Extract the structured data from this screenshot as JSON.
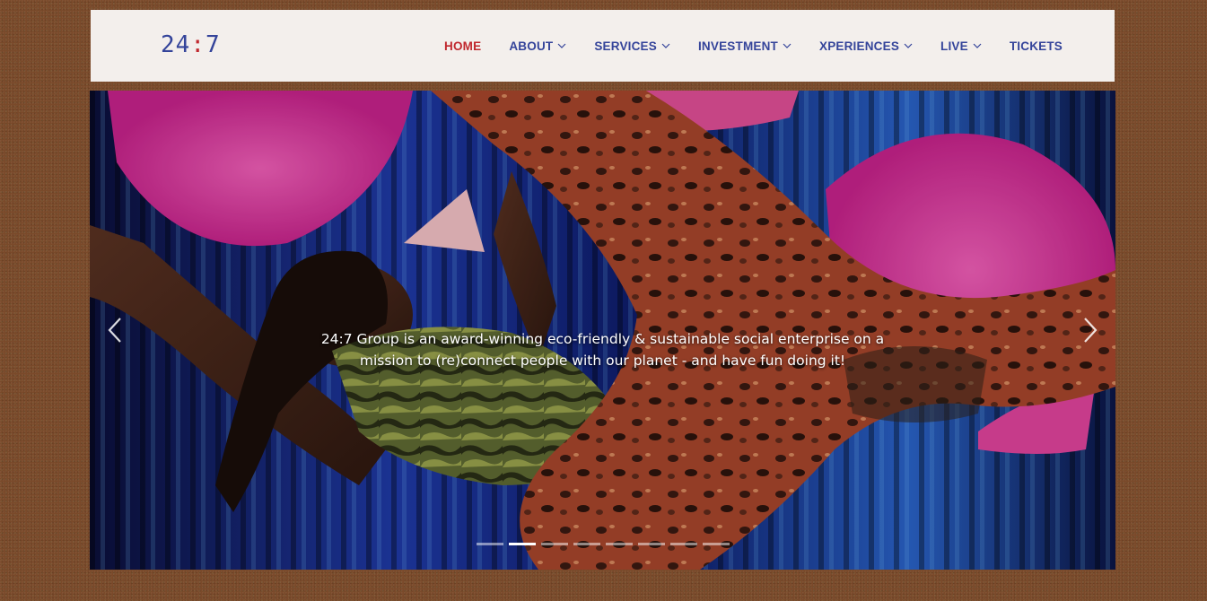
{
  "header": {
    "logo": {
      "left": "24",
      "colon": ":",
      "right": "7"
    },
    "nav": [
      {
        "label": "HOME",
        "dropdown": false,
        "active": true
      },
      {
        "label": "ABOUT",
        "dropdown": true,
        "active": false
      },
      {
        "label": "SERVICES",
        "dropdown": true,
        "active": false
      },
      {
        "label": "INVESTMENT",
        "dropdown": true,
        "active": false
      },
      {
        "label": "XPERIENCES",
        "dropdown": true,
        "active": false
      },
      {
        "label": "LIVE",
        "dropdown": true,
        "active": false
      },
      {
        "label": "TICKETS",
        "dropdown": false,
        "active": false
      }
    ]
  },
  "hero": {
    "caption_line1": "24:7 Group is an award-winning eco-friendly & sustainable social enterprise on a",
    "caption_line2": "mission to (re)connect people with our planet - and have fun doing it!",
    "prev_icon": "chevron-left-icon",
    "next_icon": "chevron-right-icon",
    "slide_count": 8,
    "active_slide": 2
  },
  "colors": {
    "nav_text": "#34449a",
    "nav_active": "#c0282e",
    "header_bg": "#f3efec",
    "page_bg": "#7a4a2a"
  }
}
